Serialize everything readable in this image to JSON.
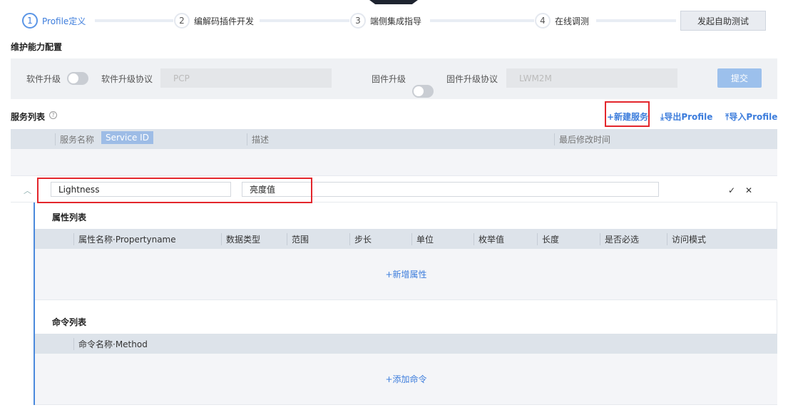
{
  "steps": [
    {
      "num": "1",
      "label": "Profile定义"
    },
    {
      "num": "2",
      "label": "编解码插件开发"
    },
    {
      "num": "3",
      "label": "端侧集成指导"
    },
    {
      "num": "4",
      "label": "在线调测"
    }
  ],
  "self_test_button": "发起自助测试",
  "maintenance": {
    "title": "维护能力配置",
    "software_upgrade": "软件升级",
    "software_protocol_label": "软件升级协议",
    "software_protocol_value": "PCP",
    "firmware_upgrade": "固件升级",
    "firmware_protocol_label": "固件升级协议",
    "firmware_protocol_value": "LWM2M",
    "submit": "提交"
  },
  "services": {
    "title": "服务列表",
    "new_service": "+新建服务",
    "export": "导出Profile",
    "import": "导入Profile",
    "columns": {
      "name": "服务名称",
      "service_id": "Service ID",
      "desc": "描述",
      "modified": "最后修改时间"
    },
    "row": {
      "service_id": "Lightness",
      "name": "亮度值",
      "desc": ""
    }
  },
  "properties": {
    "title": "属性列表",
    "columns": [
      "属性名称·Propertyname",
      "数据类型",
      "范围",
      "步长",
      "单位",
      "枚举值",
      "长度",
      "是否必选",
      "访问模式"
    ],
    "add": "+新增属性"
  },
  "commands": {
    "title": "命令列表",
    "columns": [
      "命令名称·Method"
    ],
    "add": "+添加命令"
  }
}
